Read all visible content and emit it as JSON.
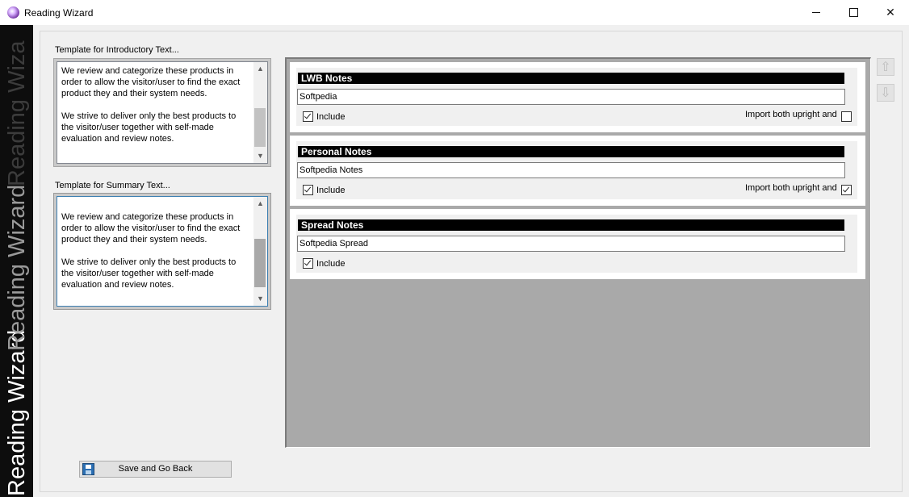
{
  "window": {
    "title": "Reading Wizard",
    "close_glyph": "✕"
  },
  "sidebar": {
    "labels": [
      "Reading Wizard",
      "Reading Wizard",
      "Reading Wiza"
    ]
  },
  "intro": {
    "label": "Template for Introductory Text...",
    "text": "We review and categorize these products in\norder to allow the visitor/user to find the exact\nproduct they and their system needs.\n\nWe strive to deliver only the best products to\nthe visitor/user together with self-made\nevaluation and review notes."
  },
  "summary": {
    "label": "Template for Summary Text...",
    "text": "We review and categorize these products in\norder to allow the visitor/user to find the exact\nproduct they and their system needs.\n\nWe strive to deliver only the best products to\nthe visitor/user together with self-made\nevaluation and review notes."
  },
  "sections": [
    {
      "title": "LWB Notes",
      "value": "Softpedia",
      "include_label": "Include",
      "include_checked": true,
      "import_label": "Import both upright and",
      "import_checked": false
    },
    {
      "title": "Personal Notes",
      "value": "Softpedia Notes",
      "include_label": "Include",
      "include_checked": true,
      "import_label": "Import both upright and",
      "import_checked": true
    },
    {
      "title": "Spread Notes",
      "value": "Softpedia Spread",
      "include_label": "Include",
      "include_checked": true
    }
  ],
  "buttons": {
    "save": "Save and Go Back",
    "up_icon": "arrow-up-icon",
    "down_icon": "arrow-down-icon"
  },
  "colors": {
    "sidebar_bg": "#0d0d0d",
    "card_header": "#000000",
    "list_bg": "#a9a9a9"
  }
}
